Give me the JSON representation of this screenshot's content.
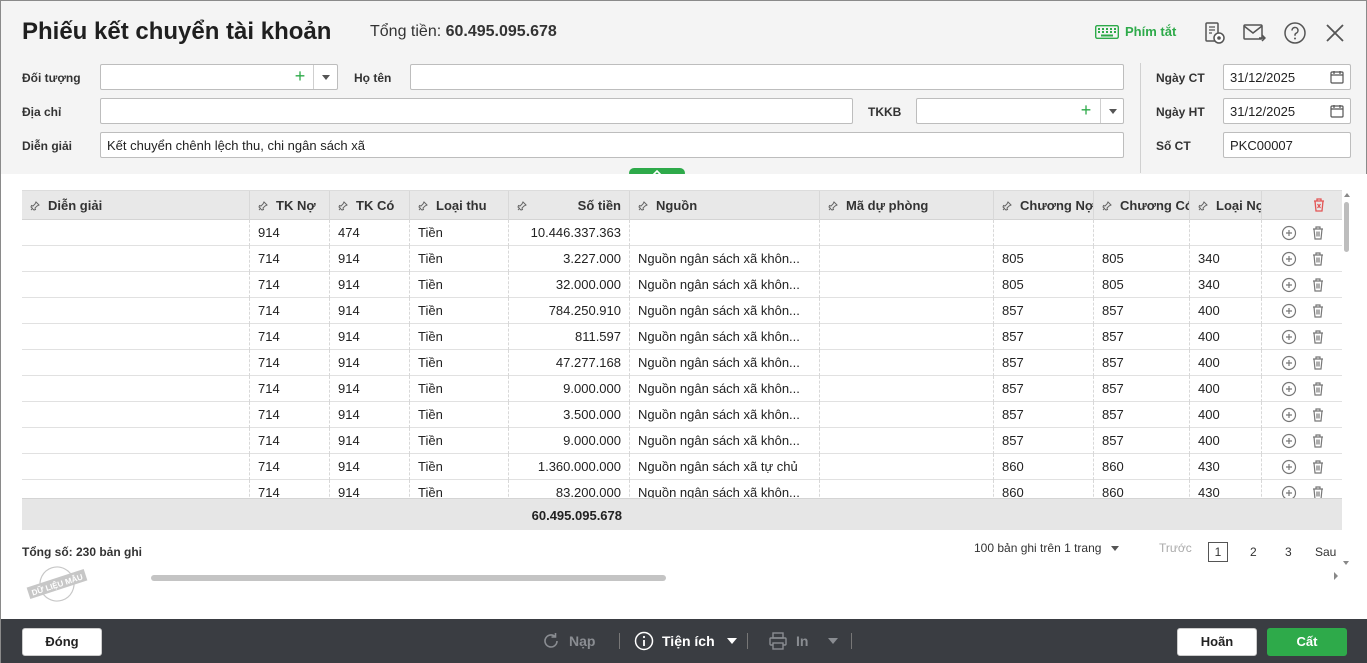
{
  "header": {
    "title": "Phiếu kết chuyển tài khoản",
    "total_label": "Tổng tiền:",
    "total_value": "60.495.095.678",
    "hotkey_label": "Phím tắt"
  },
  "form": {
    "doi_tuong_label": "Đối tượng",
    "doi_tuong_value": "",
    "ho_ten_label": "Họ tên",
    "ho_ten_value": "",
    "dia_chi_label": "Địa chỉ",
    "dia_chi_value": "",
    "tkkb_label": "TKKB",
    "tkkb_value": "",
    "dien_giai_label": "Diễn giải",
    "dien_giai_value": "Kết chuyển chênh lệch thu, chi ngân sách xã",
    "ngay_ct_label": "Ngày CT",
    "ngay_ct_value": "31/12/2025",
    "ngay_ht_label": "Ngày HT",
    "ngay_ht_value": "31/12/2025",
    "so_ct_label": "Số CT",
    "so_ct_value": "PKC00007"
  },
  "grid": {
    "columns": [
      "Diễn giải",
      "TK Nợ",
      "TK Có",
      "Loại thu",
      "Số tiền",
      "Nguồn",
      "Mã dự phòng",
      "Chương Nợ",
      "Chương Có",
      "Loại Nợ"
    ],
    "rows": [
      {
        "dien_giai": "",
        "tk_no": "914",
        "tk_co": "474",
        "loai_thu": "Tiền",
        "so_tien": "10.446.337.363",
        "nguon": "",
        "ma_du_phong": "",
        "chuong_no": "",
        "chuong_co": "",
        "loai_no": ""
      },
      {
        "dien_giai": "",
        "tk_no": "714",
        "tk_co": "914",
        "loai_thu": "Tiền",
        "so_tien": "3.227.000",
        "nguon": "Nguồn ngân sách xã khôn...",
        "ma_du_phong": "",
        "chuong_no": "805",
        "chuong_co": "805",
        "loai_no": "340"
      },
      {
        "dien_giai": "",
        "tk_no": "714",
        "tk_co": "914",
        "loai_thu": "Tiền",
        "so_tien": "32.000.000",
        "nguon": "Nguồn ngân sách xã khôn...",
        "ma_du_phong": "",
        "chuong_no": "805",
        "chuong_co": "805",
        "loai_no": "340"
      },
      {
        "dien_giai": "",
        "tk_no": "714",
        "tk_co": "914",
        "loai_thu": "Tiền",
        "so_tien": "784.250.910",
        "nguon": "Nguồn ngân sách xã khôn...",
        "ma_du_phong": "",
        "chuong_no": "857",
        "chuong_co": "857",
        "loai_no": "400"
      },
      {
        "dien_giai": "",
        "tk_no": "714",
        "tk_co": "914",
        "loai_thu": "Tiền",
        "so_tien": "811.597",
        "nguon": "Nguồn ngân sách xã khôn...",
        "ma_du_phong": "",
        "chuong_no": "857",
        "chuong_co": "857",
        "loai_no": "400"
      },
      {
        "dien_giai": "",
        "tk_no": "714",
        "tk_co": "914",
        "loai_thu": "Tiền",
        "so_tien": "47.277.168",
        "nguon": "Nguồn ngân sách xã khôn...",
        "ma_du_phong": "",
        "chuong_no": "857",
        "chuong_co": "857",
        "loai_no": "400"
      },
      {
        "dien_giai": "",
        "tk_no": "714",
        "tk_co": "914",
        "loai_thu": "Tiền",
        "so_tien": "9.000.000",
        "nguon": "Nguồn ngân sách xã khôn...",
        "ma_du_phong": "",
        "chuong_no": "857",
        "chuong_co": "857",
        "loai_no": "400"
      },
      {
        "dien_giai": "",
        "tk_no": "714",
        "tk_co": "914",
        "loai_thu": "Tiền",
        "so_tien": "3.500.000",
        "nguon": "Nguồn ngân sách xã khôn...",
        "ma_du_phong": "",
        "chuong_no": "857",
        "chuong_co": "857",
        "loai_no": "400"
      },
      {
        "dien_giai": "",
        "tk_no": "714",
        "tk_co": "914",
        "loai_thu": "Tiền",
        "so_tien": "9.000.000",
        "nguon": "Nguồn ngân sách xã khôn...",
        "ma_du_phong": "",
        "chuong_no": "857",
        "chuong_co": "857",
        "loai_no": "400"
      },
      {
        "dien_giai": "",
        "tk_no": "714",
        "tk_co": "914",
        "loai_thu": "Tiền",
        "so_tien": "1.360.000.000",
        "nguon": "Nguồn ngân sách xã tự chủ",
        "ma_du_phong": "",
        "chuong_no": "860",
        "chuong_co": "860",
        "loai_no": "430"
      },
      {
        "dien_giai": "",
        "tk_no": "714",
        "tk_co": "914",
        "loai_thu": "Tiền",
        "so_tien": "83.200.000",
        "nguon": "Nguồn ngân sách xã khôn...",
        "ma_du_phong": "",
        "chuong_no": "860",
        "chuong_co": "860",
        "loai_no": "430"
      }
    ],
    "total_so_tien": "60.495.095.678"
  },
  "footer": {
    "record_count": "Tổng số: 230 bản ghi",
    "page_size": "100 bản ghi trên 1 trang",
    "prev": "Trước",
    "pages": [
      "1",
      "2",
      "3"
    ],
    "next": "Sau",
    "stamp_text": "DỮ LIỆU MẪU"
  },
  "toolbar": {
    "close_label": "Đóng",
    "reload_label": "Nạp",
    "utilities_label": "Tiện ích",
    "print_label": "In",
    "cancel_label": "Hoãn",
    "save_label": "Cất"
  },
  "colors": {
    "accent": "#2eaa4a",
    "bottombar": "#3a3d42"
  }
}
